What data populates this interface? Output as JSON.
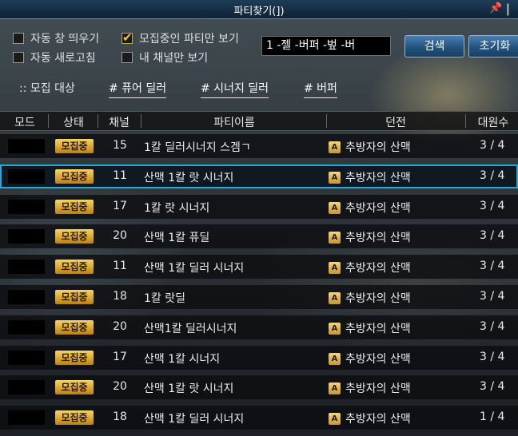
{
  "window": {
    "title": "파티찾기(])"
  },
  "options": {
    "auto_popup": {
      "label": "자동 창 띄우기",
      "checked": false
    },
    "recruiting_only": {
      "label": "모집중인 파티만 보기",
      "checked": true
    },
    "auto_refresh": {
      "label": "자동 새로고침",
      "checked": false
    },
    "my_channel_only": {
      "label": "내 채널만 보기",
      "checked": false
    }
  },
  "search": {
    "value": "1 -젤 -버퍼 -벞 -버",
    "search_label": "검색",
    "reset_label": "초기화"
  },
  "recruit_target": {
    "label": ":: 모집 대상",
    "tags": [
      "# 퓨어 딜러",
      "# 시너지 딜러",
      "# 버퍼"
    ]
  },
  "columns": {
    "mode": "모드",
    "status": "상태",
    "channel": "채널",
    "party_name": "파티이름",
    "dungeon": "던전",
    "members": "대원수"
  },
  "rows": [
    {
      "status": "모집중",
      "channel": "15",
      "party_name": "1칼 딜러시너지 스겜ㄱ",
      "dungeon": "추방자의 산맥",
      "members": "3 / 4",
      "selected": false
    },
    {
      "status": "모집중",
      "channel": "11",
      "party_name": "산맥 1칼 랏 시너지",
      "dungeon": "추방자의 산맥",
      "members": "3 / 4",
      "selected": true
    },
    {
      "status": "모집중",
      "channel": "17",
      "party_name": "1칼 랏 시너지",
      "dungeon": "추방자의 산맥",
      "members": "3 / 4",
      "selected": false
    },
    {
      "status": "모집중",
      "channel": "20",
      "party_name": "산맥 1칼 퓨딜",
      "dungeon": "추방자의 산맥",
      "members": "3 / 4",
      "selected": false
    },
    {
      "status": "모집중",
      "channel": "11",
      "party_name": "산맥 1칼 딜러 시너지",
      "dungeon": "추방자의 산맥",
      "members": "3 / 4",
      "selected": false
    },
    {
      "status": "모집중",
      "channel": "18",
      "party_name": "1칼 랏딜",
      "dungeon": "추방자의 산맥",
      "members": "3 / 4",
      "selected": false
    },
    {
      "status": "모집중",
      "channel": "20",
      "party_name": "산맥1칼 딜러시너지",
      "dungeon": "추방자의 산맥",
      "members": "3 / 4",
      "selected": false
    },
    {
      "status": "모집중",
      "channel": "17",
      "party_name": "산맥 1칼 시너지",
      "dungeon": "추방자의 산맥",
      "members": "3 / 4",
      "selected": false
    },
    {
      "status": "모집중",
      "channel": "20",
      "party_name": "산맥 1칼 랏 시너지",
      "dungeon": "추방자의 산맥",
      "members": "3 / 4",
      "selected": false
    },
    {
      "status": "모집중",
      "channel": "18",
      "party_name": "산맥 1칼 딜러 시너지",
      "dungeon": "추방자의 산맥",
      "members": "1 / 4",
      "selected": false
    }
  ],
  "icons": {
    "pin": "pin-icon",
    "close": "close-icon",
    "dungeon": "dungeon-a-icon"
  },
  "colors": {
    "accent": "#2aa6d8",
    "status_badge": "#e6b43a",
    "button": "#2f6597"
  }
}
